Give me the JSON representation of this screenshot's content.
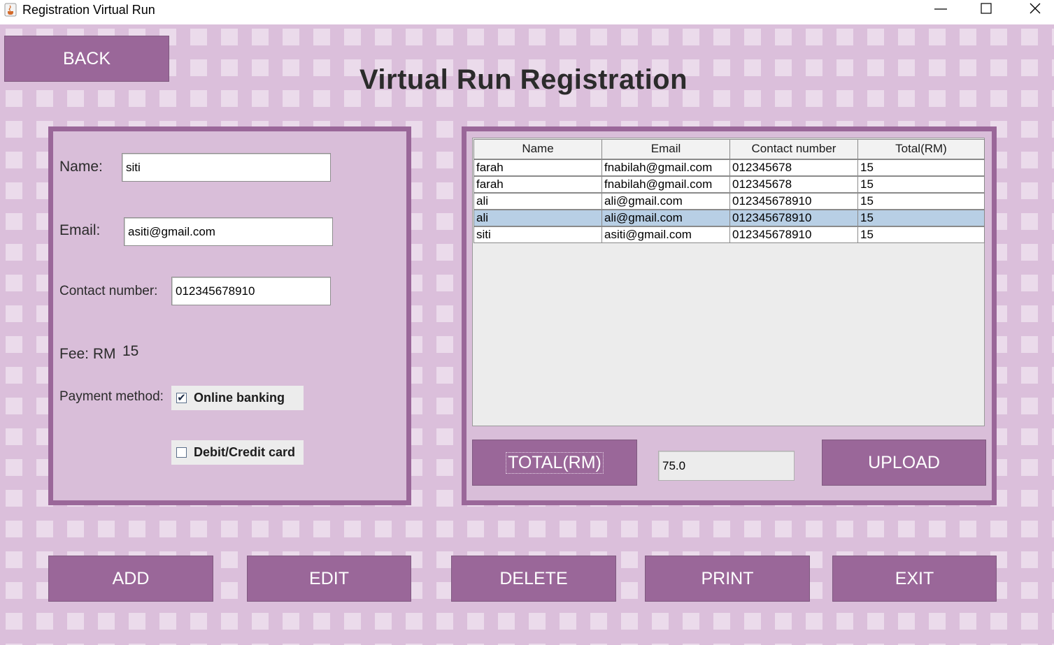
{
  "window": {
    "title": "Registration Virtual Run"
  },
  "page_title": "Virtual Run Registration",
  "buttons": {
    "back": "BACK",
    "total": "TOTAL(RM)",
    "upload": "UPLOAD",
    "add": "ADD",
    "edit": "EDIT",
    "delete": "DELETE",
    "print": "PRINT",
    "exit": "EXIT"
  },
  "form": {
    "name_label": "Name:",
    "name_value": "siti",
    "email_label": "Email:",
    "email_value": "asiti@gmail.com",
    "contact_label": "Contact number:",
    "contact_value": "012345678910",
    "fee_label": "Fee: RM",
    "fee_value": "15",
    "payment_label": "Payment method:",
    "online_banking_label": "Online banking",
    "online_banking_checked": true,
    "card_label": "Debit/Credit card",
    "card_checked": false
  },
  "table": {
    "columns": [
      "Name",
      "Email",
      "Contact number",
      "Total(RM)"
    ],
    "rows": [
      [
        "farah",
        "fnabilah@gmail.com",
        "012345678",
        "15"
      ],
      [
        "farah",
        "fnabilah@gmail.com",
        "012345678",
        "15"
      ],
      [
        "ali",
        "ali@gmail.com",
        "012345678910",
        "15"
      ],
      [
        "ali",
        "ali@gmail.com",
        "012345678910",
        "15"
      ],
      [
        "siti",
        "asiti@gmail.com",
        "012345678910",
        "15"
      ]
    ],
    "selected_row": 3
  },
  "total_value": "75.0",
  "colors": {
    "accent": "#9a6799",
    "background": "#dbbfdb",
    "selected_row": "#b8cfe5"
  }
}
